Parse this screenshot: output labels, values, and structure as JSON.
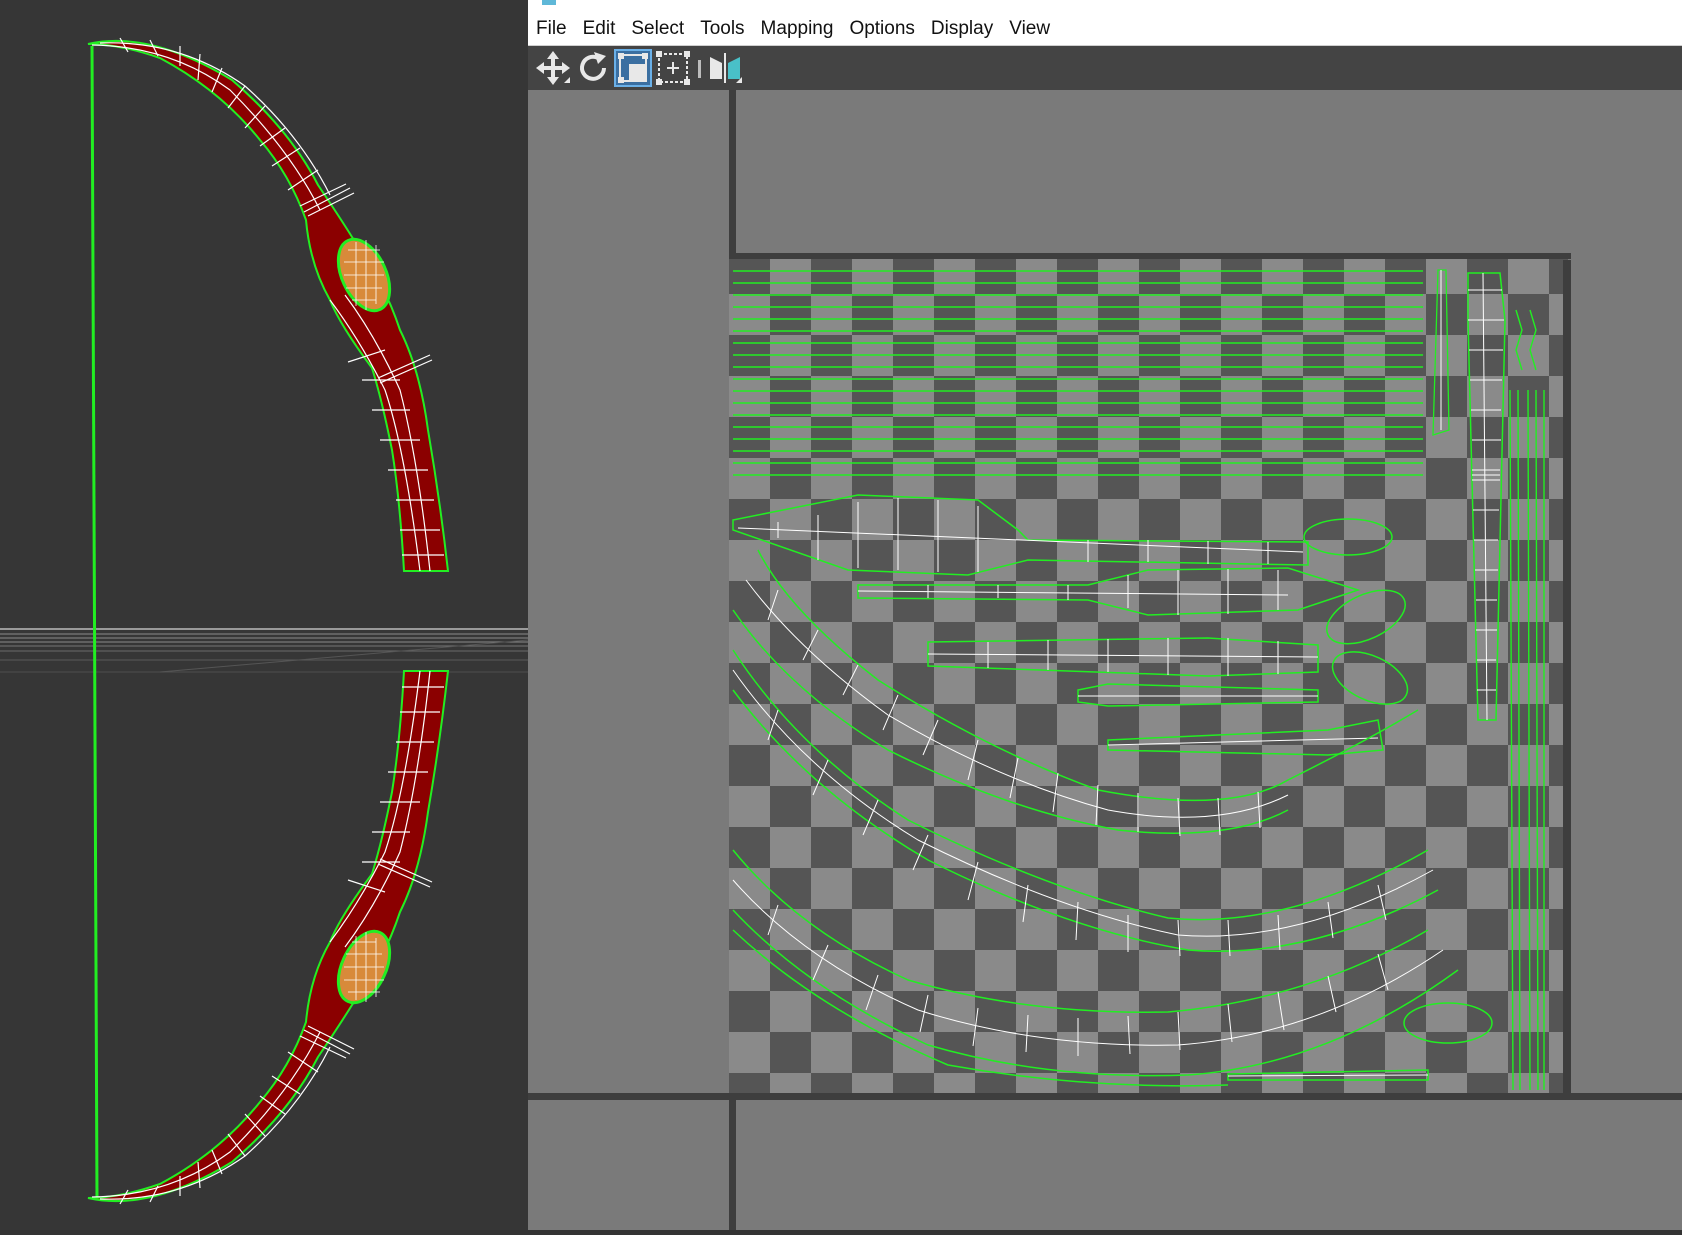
{
  "menu": {
    "items": [
      {
        "id": "file",
        "label": "File"
      },
      {
        "id": "edit",
        "label": "Edit"
      },
      {
        "id": "select",
        "label": "Select"
      },
      {
        "id": "tools",
        "label": "Tools"
      },
      {
        "id": "mapping",
        "label": "Mapping"
      },
      {
        "id": "options",
        "label": "Options"
      },
      {
        "id": "display",
        "label": "Display"
      },
      {
        "id": "view",
        "label": "View"
      }
    ]
  },
  "toolbar": {
    "tools": [
      {
        "name": "move-tool",
        "icon": "move-arrows-icon",
        "active": false
      },
      {
        "name": "rotate-tool",
        "icon": "rotate-icon",
        "active": false
      },
      {
        "name": "scale-tool",
        "icon": "scale-icon",
        "active": true
      },
      {
        "name": "freeform-tool",
        "icon": "freeform-gizmo-icon",
        "active": false
      },
      {
        "name": "mirror-tool",
        "icon": "mirror-icon",
        "active": false
      }
    ]
  },
  "colors": {
    "viewport_bg": "#363636",
    "mesh_red": "#8b0000",
    "wire_white": "#ffffff",
    "selection_green": "#22ee22",
    "grip_orange": "#d88a3a",
    "uv_bg": "#7a7a7a",
    "checker_dark": "#555555",
    "checker_light": "#8a8a8a",
    "toolbar_active": "#3b6fa1"
  },
  "uv_editor": {
    "background": "checker-texture"
  }
}
